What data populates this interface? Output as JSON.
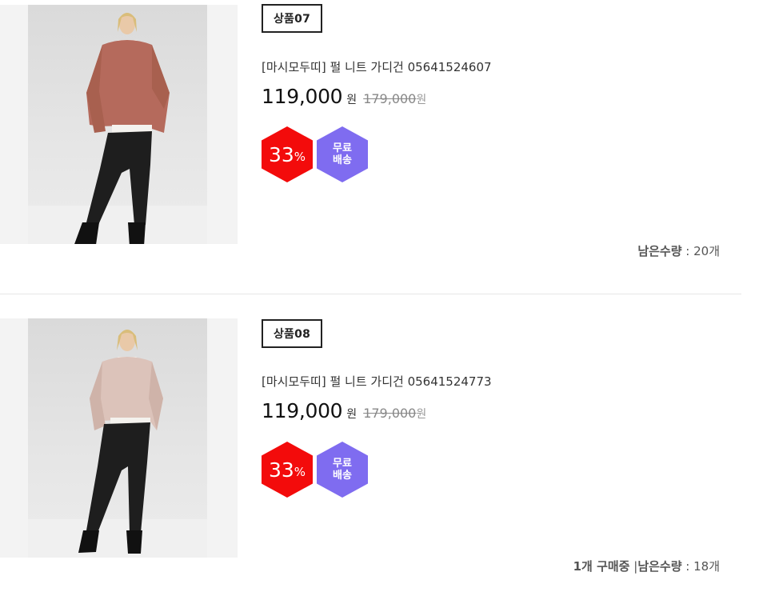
{
  "products": [
    {
      "tag": "상품07",
      "title": "[마시모두띠] 펄 니트 가디건 05641524607",
      "price": "119,000",
      "price_unit": "원",
      "original_price": "179,000",
      "original_unit": "원",
      "discount": "33",
      "discount_unit": "%",
      "shipping_line1": "무료",
      "shipping_line2": "배송",
      "stock_label": "남은수량",
      "stock_value": " : 20개",
      "cardigan_color": "#b56a5c"
    },
    {
      "tag": "상품08",
      "title": "[마시모두띠] 펄 니트 가디건 05641524773",
      "price": "119,000",
      "price_unit": "원",
      "original_price": "179,000",
      "original_unit": "원",
      "discount": "33",
      "discount_unit": "%",
      "shipping_line1": "무료",
      "shipping_line2": "배송",
      "buying_text": "1개 구매중",
      "separator": " |",
      "stock_label": "남은수량",
      "stock_value": " : 18개",
      "cardigan_color": "#dcc3ba"
    }
  ],
  "colors": {
    "sale_badge": "#f30b0b",
    "shipping_badge": "#7f6cf0"
  }
}
